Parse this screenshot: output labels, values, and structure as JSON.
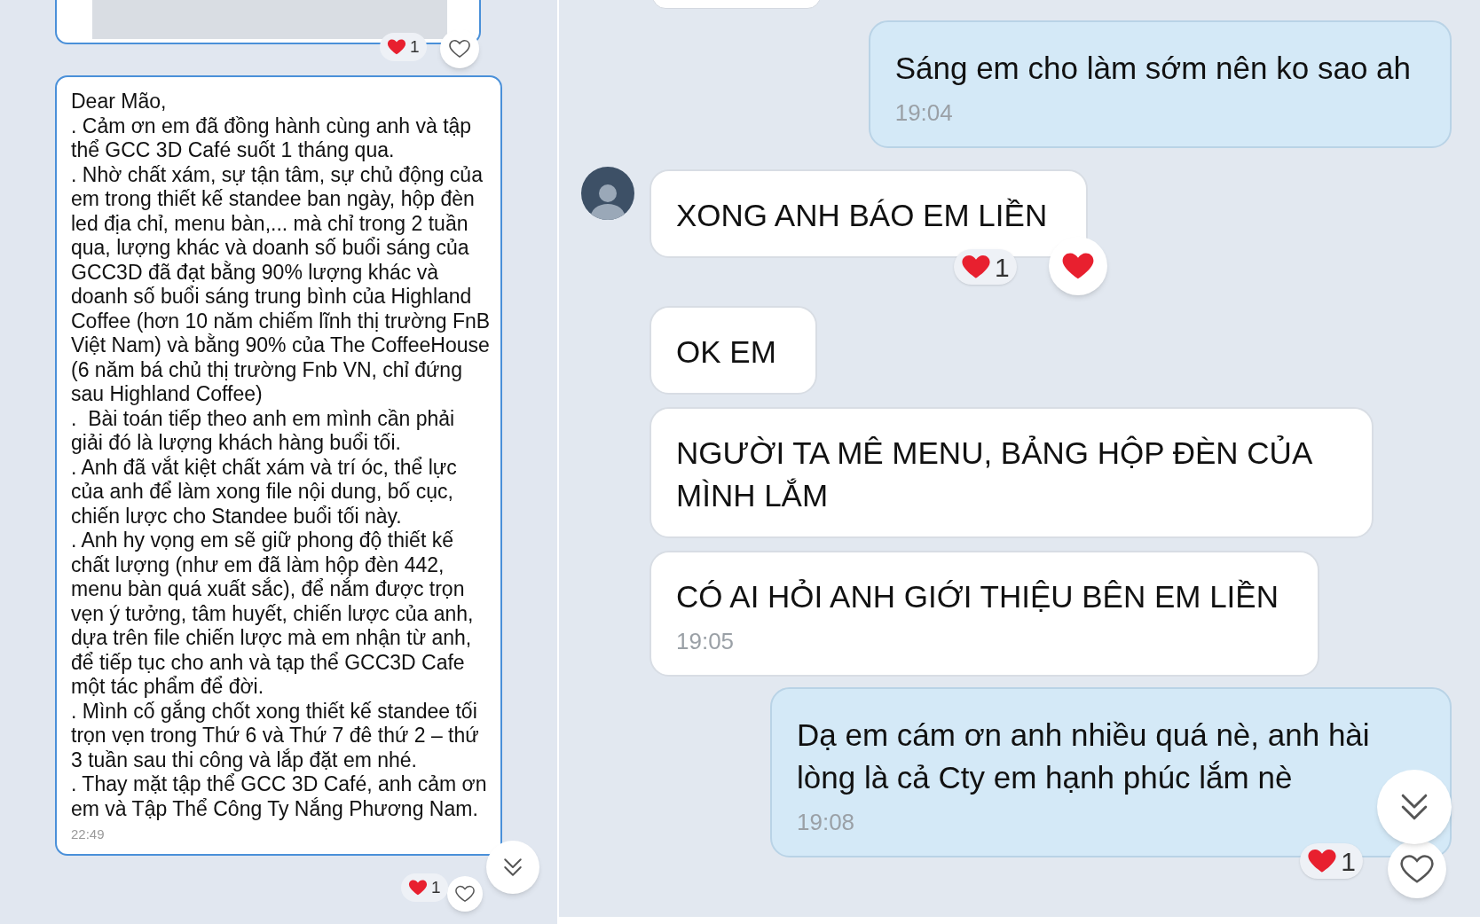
{
  "left_panel": {
    "image_message": {
      "reaction_count": "1",
      "my_reaction": false
    },
    "text_message": {
      "text": "Dear Mão,\n. Cảm ơn em đã đồng hành cùng anh và tập thể GCC 3D Café suốt 1 tháng qua.\n. Nhờ chất xám, sự tận tâm, sự chủ động của em trong thiết kế standee ban ngày, hộp đèn led địa chỉ, menu bàn,... mà chỉ trong 2 tuần qua, lượng khác và doanh số buổi sáng của GCC3D đã đạt bằng 90% lượng khác và doanh số buổi sáng trung bình của Highland Coffee (hơn 10 năm chiếm lĩnh thị trường FnB Việt Nam) và bằng 90% của The CoffeeHouse (6 năm bá chủ thị trường Fnb VN, chỉ đứng sau Highland Coffee)\n.  Bài toán tiếp theo anh em mình cần phải giải đó là lượng khách hàng buổi tối.\n. Anh đã vắt kiệt chất xám và trí óc, thể lực của anh để làm xong file nội dung, bố cục, chiến lược cho Standee buổi tối này.\n. Anh hy vọng em sẽ giữ phong độ thiết kế chất lượng (như em đã làm hộp đèn 442, menu bàn quá xuất sắc), để nắm được trọn vẹn ý tưởng, tâm huyết, chiến lược của anh, dựa trên file chiến lược mà em nhận từ anh, để tiếp tục cho anh và tạp thể GCC3D Cafe một tác phẩm để đời.\n. Mình cố gắng chốt xong thiết kế standee tối trọn vẹn trong Thứ 6 và Thứ 7 đê thứ 2 – thứ 3 tuần sau thi công và lắp đặt em nhé.\n. Thay mặt tập thể GCC 3D Café, anh cảm ơn em và Tập Thể Công Ty Nắng Phương Nam.",
      "time": "22:49",
      "reaction_count": "1",
      "my_reaction": false
    }
  },
  "right_panel": {
    "messages": [
      {
        "kind": "sent",
        "text": "Sáng em cho làm sớm nên ko sao ah",
        "time": "19:04"
      },
      {
        "kind": "received",
        "avatar": true,
        "text": "XONG ANH BÁO EM LIỀN",
        "reaction_count": "1",
        "my_reaction": true
      },
      {
        "kind": "received",
        "avatar": false,
        "text": "OK EM"
      },
      {
        "kind": "received",
        "avatar": false,
        "text": "NGƯỜI TA MÊ MENU, BẢNG HỘP ĐÈN CỦA MÌNH LẮM"
      },
      {
        "kind": "received",
        "avatar": false,
        "text": "CÓ AI HỎI ANH GIỚI THIỆU BÊN EM LIỀN",
        "time": "19:05"
      },
      {
        "kind": "sent",
        "text": "Dạ em cám ơn anh nhiều quá nè, anh hài lòng là cả Cty em hạnh phúc lắm nè",
        "time": "19:08",
        "reaction_count": "1",
        "my_reaction": false
      }
    ]
  }
}
